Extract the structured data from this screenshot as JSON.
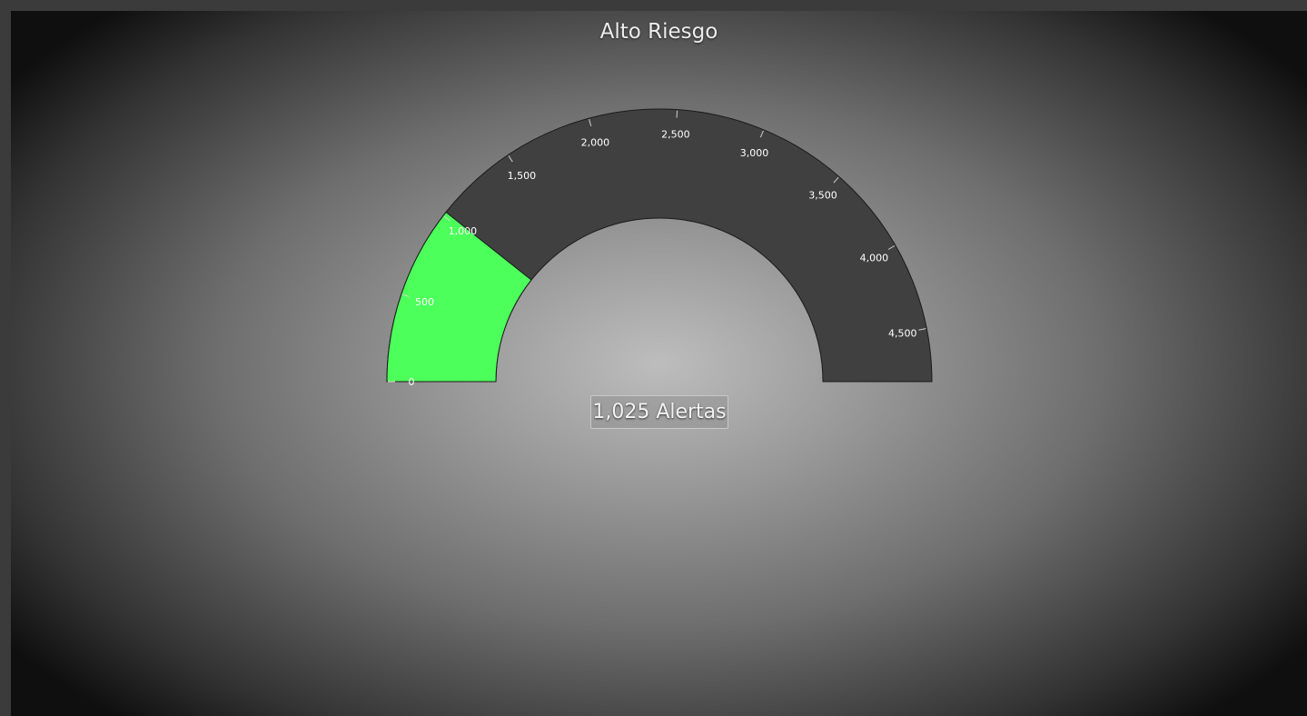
{
  "chart_data": {
    "type": "gauge",
    "title": "Alto Riesgo",
    "min": 0,
    "max": 4800,
    "value": 1025,
    "value_label": "1,025 Alertas",
    "tick_values": [
      0,
      500,
      1000,
      1500,
      2000,
      2500,
      3000,
      3500,
      4000,
      4500
    ],
    "tick_labels": [
      "0",
      "500",
      "1,000",
      "1,500",
      "2,000",
      "2,500",
      "3,000",
      "3,500",
      "4,000",
      "4,500"
    ],
    "colors": {
      "fill": "#4cff5a",
      "track": "#404040",
      "outline": "#1a1a1a"
    }
  }
}
